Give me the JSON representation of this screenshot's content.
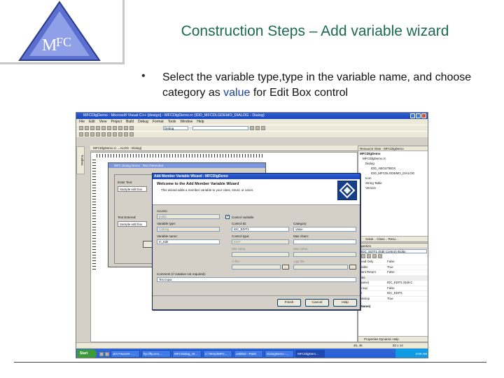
{
  "slide": {
    "title": "Construction Steps – Add variable wizard",
    "bullet_marker": "•",
    "bullet_prefix": "Select the variable type,type in the variable name, and choose category as ",
    "bullet_keyword": "value",
    "bullet_suffix": " for Edit Box control",
    "logo_text_m": "M",
    "logo_text_fc": "FC"
  },
  "ide": {
    "window_title": "MFCDlgDemo - Microsoft Visual C++ [design] - MFCDlgDemo.rc (IDD_MFCDLGDEMO_DIALOG - Dialog)",
    "menu": [
      "File",
      "Edit",
      "View",
      "Project",
      "Build",
      "Debug",
      "Format",
      "Tools",
      "Window",
      "Help"
    ],
    "config_combo": "Debug",
    "doc_tab": "MFCDlgDemo.rc ...ALOG - Dialog)",
    "toolbox_tab": "Toolbox",
    "design_dialog": {
      "caption": "MFC Dialog Demo : Text Generator",
      "enter_text_label": "Enter Text:",
      "enter_text_value": "Sample edit box",
      "text_entered_label": "Text Entered:",
      "text_entered_value": "Sample edit box",
      "add_button": "Add"
    },
    "resource_view": {
      "header": "Resource View - MFCDlgDemo",
      "items": [
        "MFCDlgDemo",
        "MFCDlgDemo.rc",
        "Dialog",
        "IDD_ABOUTBOX",
        "IDD_MFCDLGDEMO_DIALOG",
        "Icon",
        "String Table",
        "Version"
      ],
      "tabs": "Soluti... Class... Reso..."
    },
    "properties": {
      "header": "operties",
      "object": "IDC_EDIT1 (Edit Control)  IEdito",
      "rows": [
        [
          "Read Only",
          "False"
        ],
        [
          "Visible",
          "True"
        ],
        [
          "Want Return",
          "False"
        ],
        [
          "Misc",
          ""
        ],
        [
          "(Name)",
          "IDC_EDIT1 (Edit C"
        ],
        [
          "Group",
          "False"
        ],
        [
          "ID",
          "IDC_EDIT1"
        ],
        [
          "Tabstop",
          "True"
        ]
      ],
      "name_caption": "(Name)",
      "tabs": "Properties  Dynamic Help"
    },
    "status": {
      "pos": "45, 45",
      "size": "82 x 14"
    },
    "taskbar": {
      "start": "Start",
      "items": [
        "Jim Fawcett - ...",
        "ftp://ftp.ecs....",
        "MFCDialog_St...",
        "C:\\Temp\\MFC...",
        "untitled - Paint",
        "DialogDemo -...",
        "MFCDlgDem..."
      ],
      "clock": "2:00 AM"
    }
  },
  "wizard": {
    "title": "Add Member Variable Wizard - MFCDlgDemo",
    "heading": "Welcome to the Add Member Variable Wizard",
    "subheading": "This wizard adds a member variable to your class, struct, or union.",
    "access_label": "Access:",
    "access_value": "public",
    "control_variable_label": "Control variable",
    "control_variable_checked": "✓",
    "variable_type_label": "Variable type:",
    "variable_type_value": "CString",
    "control_id_label": "Control ID:",
    "control_id_value": "IDC_EDIT1",
    "category_label": "Category:",
    "category_value": "Value",
    "variable_name_label": "Variable name:",
    "variable_name_value": "m_Edit",
    "control_type_label": "Control type:",
    "control_type_value": "EDIT",
    "max_chars_label": "Max chars:",
    "min_value_label": "Min value:",
    "max_value_label": "Max value:",
    "h_file_label": ".h file:",
    "cpp_file_label": ".cpp file:",
    "comment_label": "Comment (// notation not required):",
    "comment_value": "Text Input",
    "browse": "...",
    "buttons": {
      "finish": "Finish",
      "cancel": "Cancel",
      "help": "Help"
    }
  }
}
